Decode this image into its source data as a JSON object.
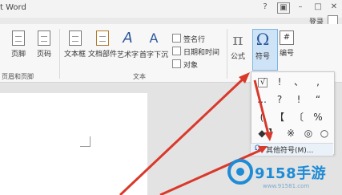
{
  "window": {
    "title": "t Word",
    "login": "登录"
  },
  "ribbon": {
    "buttons": [
      {
        "label": "页脚"
      },
      {
        "label": "页码"
      },
      {
        "label": "文本框"
      },
      {
        "label": "文档部件"
      },
      {
        "label": "艺术字"
      },
      {
        "label": "首字下沉"
      },
      {
        "label": "公式"
      },
      {
        "label": "符号"
      },
      {
        "label": "编号"
      }
    ],
    "small_items": [
      {
        "label": "签名行"
      },
      {
        "label": "日期和时间"
      },
      {
        "label": "对象"
      }
    ],
    "groups": [
      {
        "label": "页眉和页脚"
      },
      {
        "label": "文本"
      }
    ]
  },
  "symbol_panel": {
    "symbols": [
      "√",
      "!",
      "、",
      ",",
      "…",
      "?",
      "!",
      "“",
      "(",
      "【",
      "〔",
      "%",
      "◆",
      "】",
      "※",
      "◎",
      "○"
    ],
    "more_label": "其他符号(M)..."
  },
  "watermark": {
    "text": "9158手游",
    "url": "www.91581.com"
  },
  "colors": {
    "accent": "#2b579a",
    "arrow": "#d9392b",
    "highlight": "#cfe3f7",
    "watermark": "#1e8bd6"
  }
}
